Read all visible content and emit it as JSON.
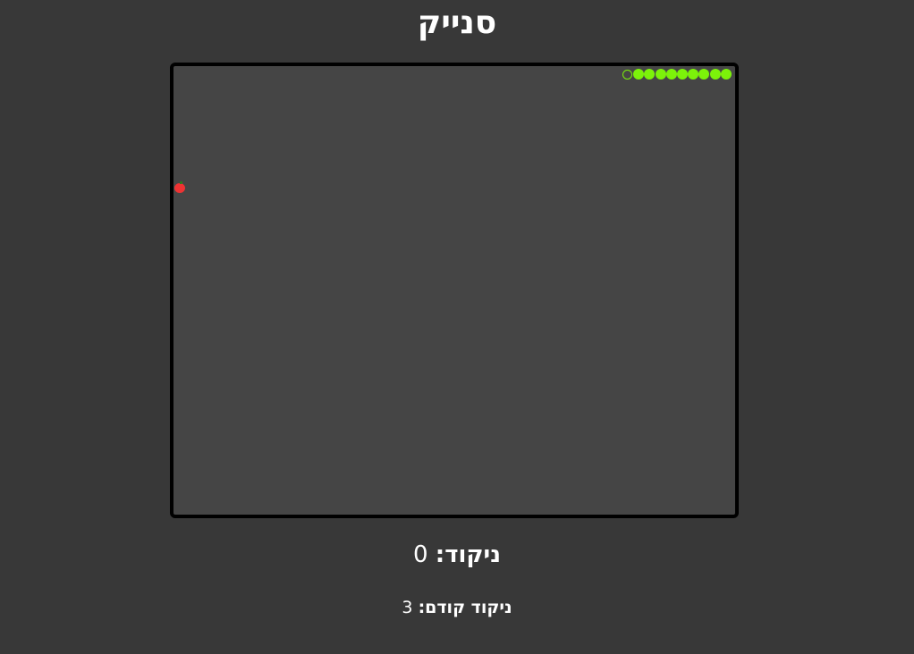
{
  "game": {
    "title": "סנייק",
    "score_label": "ניקוד:",
    "score_value": "0",
    "prev_score_label": "ניקוד קודם:",
    "prev_score_value": "3",
    "snake_length": 10,
    "colors": {
      "background": "#383838",
      "board": "#454545",
      "border": "#000000",
      "snake": "#7cf20a",
      "apple": "#ee3333"
    }
  }
}
